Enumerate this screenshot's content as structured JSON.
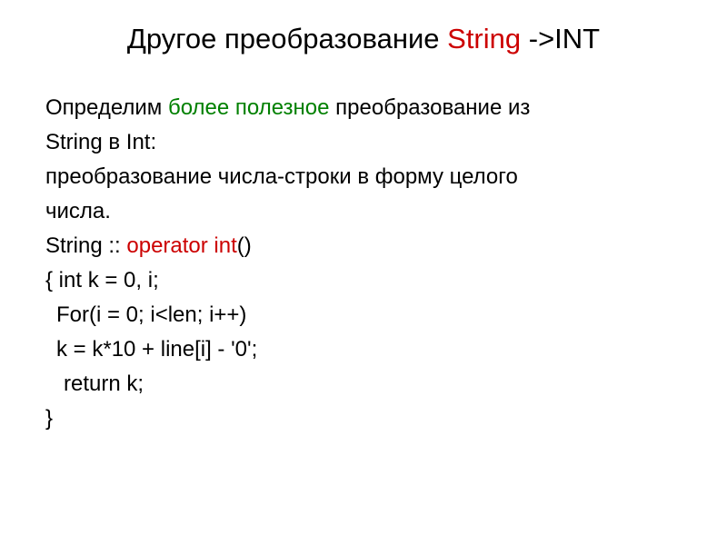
{
  "title": {
    "part1": "Другое преобразование ",
    "part2": "String ",
    "part3": "->INT"
  },
  "body": {
    "line1_a": "Определим ",
    "line1_b": "более полезное ",
    "line1_c": "преобразование из",
    "line2": "String в Int:",
    "line3": "преобразование числа-строки в форму целого",
    "line4": "числа.",
    "line5_a": "String  :: ",
    "line5_b": "operator int",
    "line5_c": "()",
    "line6": "{ int k = 0, i;",
    "line7": "For(i = 0; i<len; i++)",
    "line8": "k = k*10 + line[i] - '0';",
    "line9": "return k;",
    "line10": "}"
  }
}
